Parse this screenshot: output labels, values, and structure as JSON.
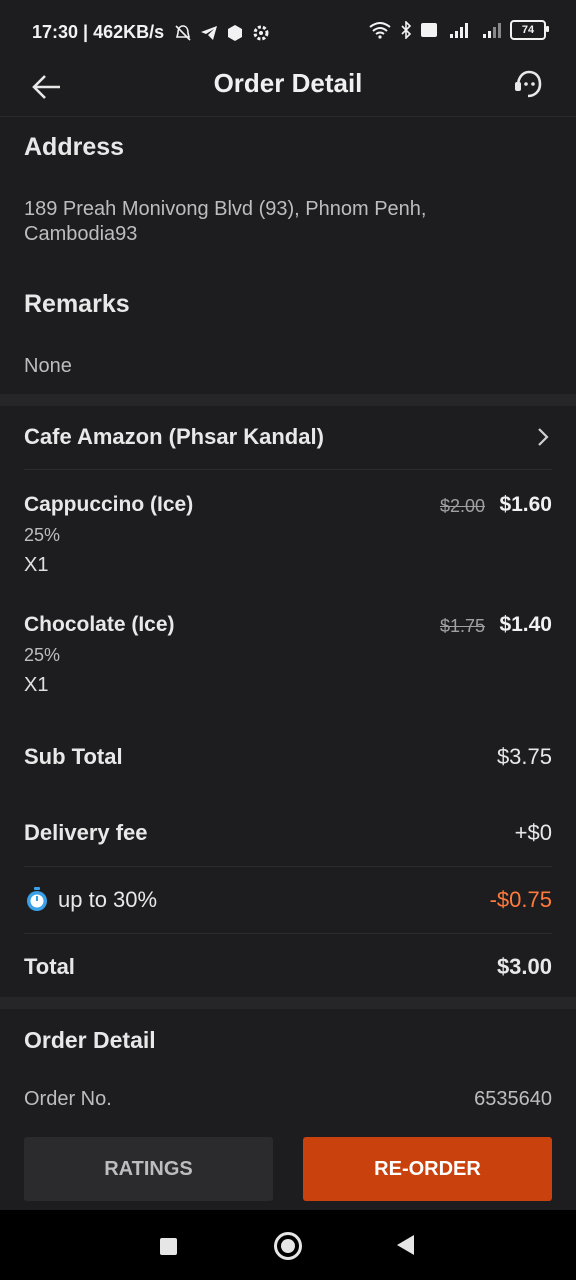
{
  "status_bar": {
    "time_speed": "17:30 | 462KB/s",
    "battery": "74"
  },
  "appbar": {
    "title": "Order Detail"
  },
  "address": {
    "heading": "Address",
    "line1": "189 Preah Monivong Blvd (93), Phnom Penh,",
    "line2": "Cambodia93"
  },
  "remarks": {
    "heading": "Remarks",
    "text": "None"
  },
  "store": {
    "name": "Cafe Amazon (Phsar Kandal)"
  },
  "items": [
    {
      "name": "Cappuccino (Ice)",
      "discount": "25%",
      "qty": "X1",
      "old_price": "$2.00",
      "price": "$1.60"
    },
    {
      "name": "Chocolate (Ice)",
      "discount": "25%",
      "qty": "X1",
      "old_price": "$1.75",
      "price": "$1.40"
    }
  ],
  "summary": {
    "subtotal_label": "Sub Total",
    "subtotal_value": "$3.75",
    "delivery_label": "Delivery fee",
    "delivery_value": "+$0",
    "promo_label": "up to 30%",
    "promo_value": "-$0.75",
    "total_label": "Total",
    "total_value": "$3.00"
  },
  "order_detail": {
    "heading": "Order Detail",
    "order_no_label": "Order No.",
    "order_no_value": "6535640"
  },
  "buttons": {
    "ratings": "RATINGS",
    "reorder": "RE-ORDER"
  },
  "colors": {
    "accent": "#c9410c",
    "discount": "#ff7a3c",
    "background": "#1d1d1f"
  }
}
